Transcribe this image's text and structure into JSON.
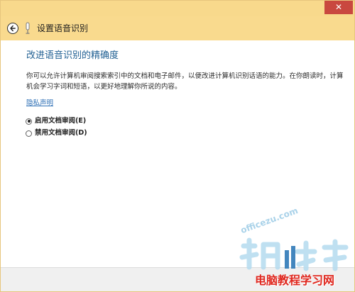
{
  "window": {
    "close_glyph": "✕",
    "titlebar_color": "#f8d98c",
    "close_color": "#c9483f"
  },
  "nav": {
    "title": "设置语音识别",
    "back_icon": "back-arrow-icon",
    "mic_icon": "microphone-icon"
  },
  "main": {
    "heading": "改进语音识别的精确度",
    "description": "你可以允许计算机审阅搜索索引中的文档和电子邮件，以便改进计算机识别话语的能力。在你朗读时，计算机会学习字词和短语，以更好地理解你所说的内容。",
    "privacy_link": "隐私声明",
    "options": [
      {
        "label": "启用文档审阅(E)",
        "checked": true
      },
      {
        "label": "禁用文档审阅(D)",
        "checked": false
      }
    ]
  },
  "watermark": {
    "url": "officezu.com",
    "text": "电脑教程学习网"
  }
}
